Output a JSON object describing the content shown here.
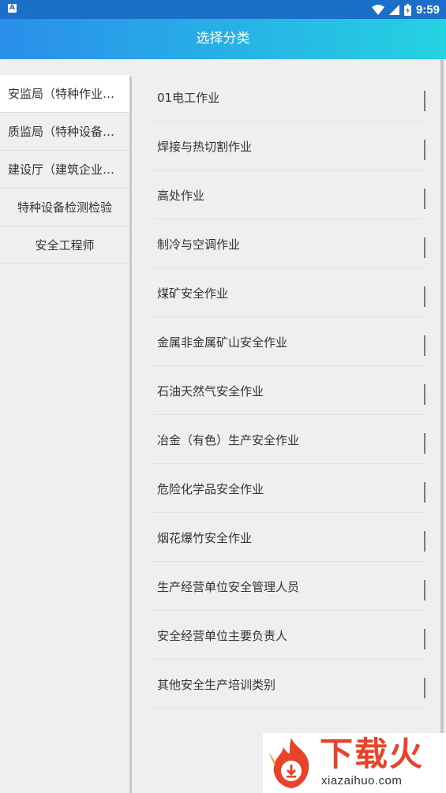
{
  "status_bar": {
    "time": "9:59",
    "notification_icon_letter": "A",
    "icons": [
      "wifi-icon",
      "signal-icon",
      "battery-icon"
    ]
  },
  "header": {
    "title": "选择分类",
    "gradient_start": "#2a8eeb",
    "gradient_end": "#25d2e2"
  },
  "sidebar": {
    "items": [
      {
        "label": "安监局（特种作业操作证）",
        "selected": true
      },
      {
        "label": "质监局（特种设备作业人员）",
        "selected": false
      },
      {
        "label": "建设厅（建筑企业从业人员）",
        "selected": false
      },
      {
        "label": "特种设备检测检验",
        "selected": false
      },
      {
        "label": "安全工程师",
        "selected": false
      }
    ]
  },
  "main": {
    "items": [
      {
        "label": "01电工作业"
      },
      {
        "label": "焊接与热切割作业"
      },
      {
        "label": "高处作业"
      },
      {
        "label": "制冷与空调作业"
      },
      {
        "label": "煤矿安全作业"
      },
      {
        "label": "金属非金属矿山安全作业"
      },
      {
        "label": "石油天然气安全作业"
      },
      {
        "label": "冶金（有色）生产安全作业"
      },
      {
        "label": "危险化学品安全作业"
      },
      {
        "label": "烟花爆竹安全作业"
      },
      {
        "label": "生产经营单位安全管理人员"
      },
      {
        "label": "安全经营单位主要负责人"
      },
      {
        "label": "其他安全生产培训类别"
      }
    ]
  },
  "watermark": {
    "brand": "下载火",
    "url": "xiazaihuo.com",
    "color": "#e8432a"
  }
}
